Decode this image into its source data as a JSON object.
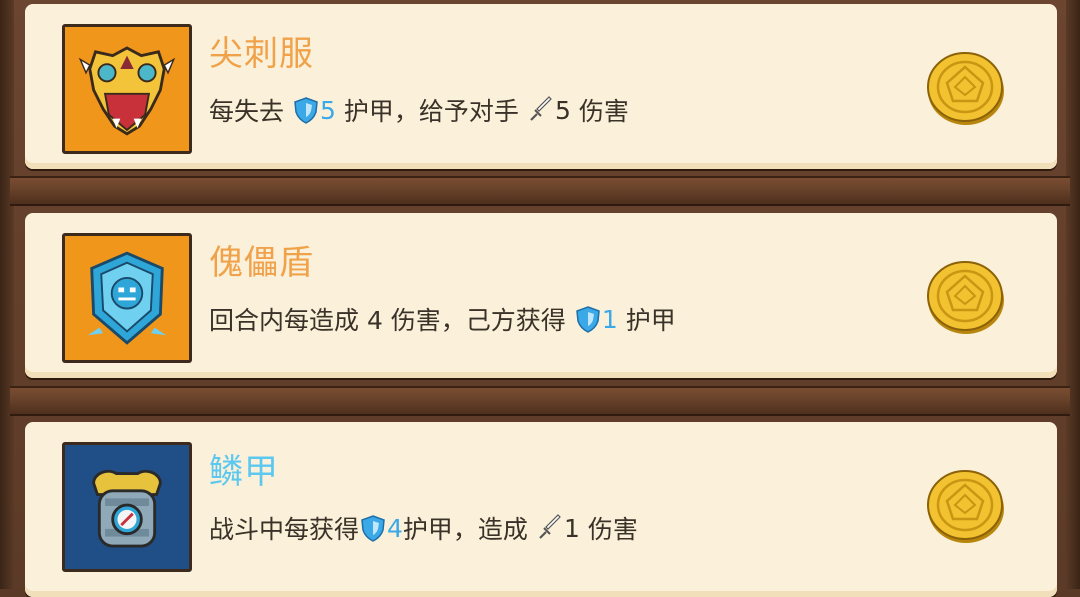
{
  "items": [
    {
      "name": "尖刺服",
      "name_color": "#f0a24a",
      "icon": "spiked-armor-icon",
      "icon_bg": "#f0961a",
      "desc": {
        "p1": "每失去",
        "armor_value": "5",
        "p2": "护甲，给予对手",
        "damage_value": "5",
        "p3": "伤害"
      }
    },
    {
      "name": "傀儡盾",
      "name_color": "#f0a24a",
      "icon": "golem-shield-icon",
      "icon_bg": "#f0961a",
      "desc": {
        "p1": "回合内每造成 4 伤害，己方获得",
        "armor_value": "1",
        "p2": "护甲"
      }
    },
    {
      "name": "鳞甲",
      "name_color": "#5cc8f0",
      "icon": "scale-armor-icon",
      "icon_bg": "#1f4f86",
      "desc": {
        "p1": "战斗中每获得",
        "armor_value": "4",
        "p2": "护甲，造成",
        "damage_value": "1",
        "p3": "伤害"
      }
    }
  ],
  "icons": {
    "armor": "shield-icon",
    "damage": "sword-icon",
    "price": "gold-coin-icon"
  }
}
